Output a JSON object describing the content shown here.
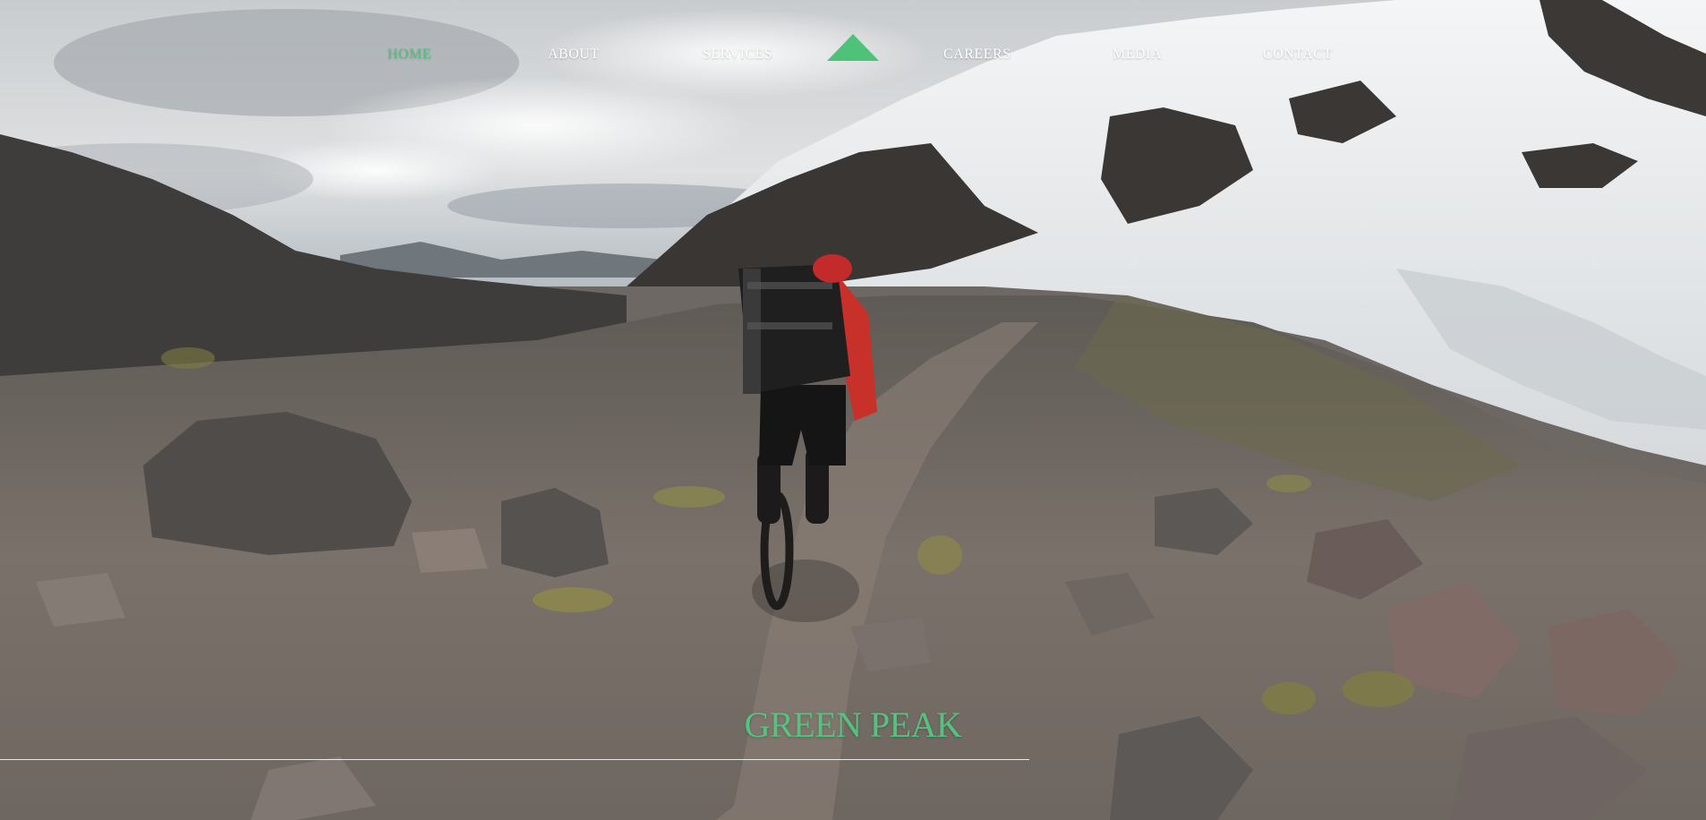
{
  "nav": {
    "items": [
      {
        "label": "HOME",
        "active": true
      },
      {
        "label": "ABOUT",
        "active": false
      },
      {
        "label": "SERVICES",
        "active": false
      },
      {
        "label": "CAREERS",
        "active": false
      },
      {
        "label": "MEDIA",
        "active": false
      },
      {
        "label": "CONTACT",
        "active": false
      }
    ],
    "logo_icon": "mountain-triangle-icon"
  },
  "hero": {
    "title": "GREEN PEAK",
    "background_subject": "mountain-biker-on-rocky-trail-with-snowy-peaks"
  },
  "colors": {
    "accent": "#52c47d",
    "nav_text": "#ffffff"
  }
}
